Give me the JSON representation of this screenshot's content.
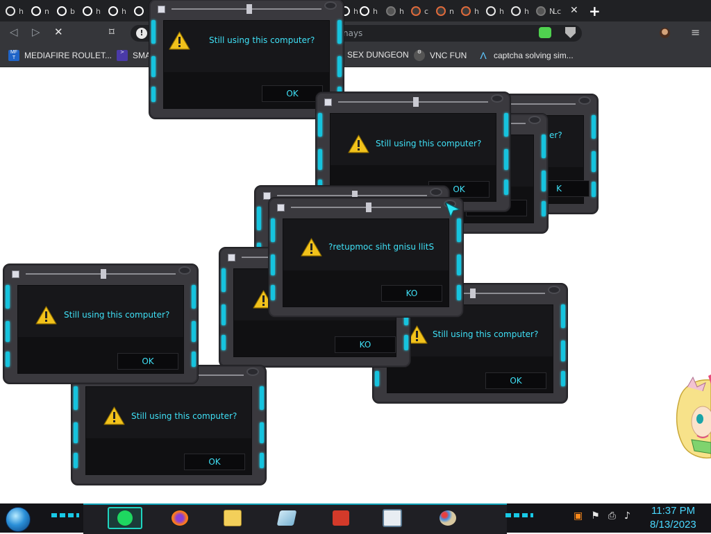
{
  "browser": {
    "tabs": [
      {
        "icon": "history-icon",
        "label": "h"
      },
      {
        "icon": "google-icon",
        "label": "n"
      },
      {
        "icon": "google-icon",
        "label": "b"
      },
      {
        "icon": "google-icon",
        "label": "h"
      },
      {
        "icon": "google-icon",
        "label": "h"
      },
      {
        "icon": "google-icon",
        "label": ""
      },
      {
        "icon": "google-icon",
        "label": "h"
      },
      {
        "icon": "google-icon",
        "label": "h"
      },
      {
        "icon": "dark-icon",
        "label": "h"
      },
      {
        "icon": "orange-icon",
        "label": "c"
      },
      {
        "icon": "orange-icon",
        "label": "n"
      },
      {
        "icon": "orange-icon",
        "label": "h"
      },
      {
        "icon": "dark-icon",
        "label": "h"
      },
      {
        "icon": "dark-icon",
        "label": "h"
      },
      {
        "icon": "dark-icon",
        "label": "h"
      },
      {
        "icon": "dark-icon",
        "label": "N"
      },
      {
        "icon": "dark-icon",
        "label": "Lc"
      }
    ],
    "close_tab_glyph": "✕",
    "new_tab_glyph": "+",
    "url_partial": "nays",
    "bookmarks": [
      {
        "label": "MEDIAFIRE ROULET...",
        "icon": "mediafire-icon"
      },
      {
        "label": "SMA",
        "icon": "visual-studio-icon"
      },
      {
        "label": "SEX DUNGEON",
        "icon": "blank-icon"
      },
      {
        "label": "VNC FUN",
        "icon": "vnc-icon"
      },
      {
        "label": "captcha solving sim...",
        "icon": "arc-icon"
      }
    ]
  },
  "dialogs": [
    {
      "message": "Still using this computer?",
      "ok": "OK"
    },
    {
      "message": "er?",
      "ok": "K"
    },
    {
      "message": "",
      "ok": "OK"
    },
    {
      "message": "Still using this computer?",
      "ok": "OK"
    },
    {
      "message": "",
      "ok": ""
    },
    {
      "message": "Still using this computer?",
      "ok": "OK"
    },
    {
      "message": "",
      "ok": "KO"
    },
    {
      "message": "?retupmoc siht gnisu llitS",
      "ok": "KO"
    },
    {
      "message": "Still using this computer?",
      "ok": "OK"
    },
    {
      "message": "Still using this computer?",
      "ok": "OK"
    }
  ],
  "taskbar": {
    "time": "11:37 PM",
    "date": "8/13/2023",
    "apps": [
      "spotify-icon",
      "firefox-icon",
      "file-explorer-icon",
      "notepad-icon",
      "toolbox-icon",
      "window-icon",
      "paint-icon"
    ],
    "tray": [
      "language-icon",
      "flag-icon",
      "network-icon",
      "volume-icon"
    ]
  },
  "colors": {
    "accent_cyan": "#3fe0f6",
    "neon": "#16c3de",
    "dialog_body": "#3a393e",
    "taskbar": "#141418"
  }
}
